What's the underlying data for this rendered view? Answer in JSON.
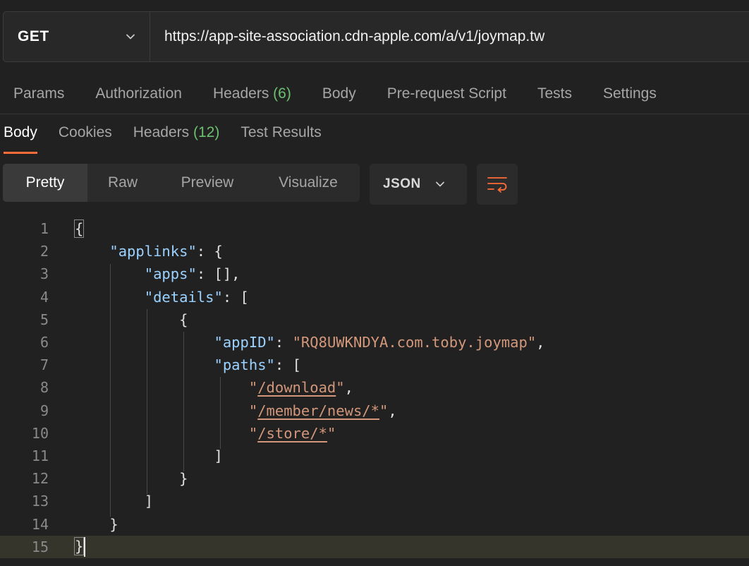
{
  "request": {
    "method": "GET",
    "url": "https://app-site-association.cdn-apple.com/a/v1/joymap.tw"
  },
  "request_tabs": [
    {
      "label": "Params"
    },
    {
      "label": "Authorization"
    },
    {
      "label": "Headers",
      "count": "(6)"
    },
    {
      "label": "Body"
    },
    {
      "label": "Pre-request Script"
    },
    {
      "label": "Tests"
    },
    {
      "label": "Settings"
    }
  ],
  "response_tabs": [
    {
      "label": "Body",
      "active": true
    },
    {
      "label": "Cookies"
    },
    {
      "label": "Headers",
      "count": "(12)"
    },
    {
      "label": "Test Results"
    }
  ],
  "view_modes": [
    "Pretty",
    "Raw",
    "Preview",
    "Visualize"
  ],
  "active_view": "Pretty",
  "format": "JSON",
  "icons": {
    "method_dropdown": "chevron-down-icon",
    "format_dropdown": "chevron-down-icon",
    "wrap": "wrap-lines-icon"
  },
  "colors": {
    "accent": "#ff6c37",
    "count": "#6cc070",
    "key": "#9cd2ff",
    "string": "#d3977b"
  },
  "code": {
    "current_line": 15,
    "lines": [
      {
        "n": "1",
        "parts": [
          {
            "t": "{",
            "c": "brace-box"
          }
        ]
      },
      {
        "n": "2",
        "parts": [
          {
            "t": "    "
          },
          {
            "t": "\"applinks\"",
            "c": "key"
          },
          {
            "t": ": {"
          }
        ]
      },
      {
        "n": "3",
        "parts": [
          {
            "t": "        "
          },
          {
            "t": "\"apps\"",
            "c": "key"
          },
          {
            "t": ": [],"
          }
        ]
      },
      {
        "n": "4",
        "parts": [
          {
            "t": "        "
          },
          {
            "t": "\"details\"",
            "c": "key"
          },
          {
            "t": ": ["
          }
        ]
      },
      {
        "n": "5",
        "parts": [
          {
            "t": "            {"
          }
        ]
      },
      {
        "n": "6",
        "parts": [
          {
            "t": "                "
          },
          {
            "t": "\"appID\"",
            "c": "key"
          },
          {
            "t": ": "
          },
          {
            "t": "\"RQ8UWKNDYA.com.toby.joymap\"",
            "c": "str"
          },
          {
            "t": ","
          }
        ]
      },
      {
        "n": "7",
        "parts": [
          {
            "t": "                "
          },
          {
            "t": "\"paths\"",
            "c": "key"
          },
          {
            "t": ": ["
          }
        ]
      },
      {
        "n": "8",
        "parts": [
          {
            "t": "                    "
          },
          {
            "t": "\"",
            "c": "str"
          },
          {
            "t": "/download",
            "c": "lnk"
          },
          {
            "t": "\"",
            "c": "str"
          },
          {
            "t": ","
          }
        ]
      },
      {
        "n": "9",
        "parts": [
          {
            "t": "                    "
          },
          {
            "t": "\"",
            "c": "str"
          },
          {
            "t": "/member/news/*",
            "c": "lnk"
          },
          {
            "t": "\"",
            "c": "str"
          },
          {
            "t": ","
          }
        ]
      },
      {
        "n": "10",
        "parts": [
          {
            "t": "                    "
          },
          {
            "t": "\"",
            "c": "str"
          },
          {
            "t": "/store/*",
            "c": "lnk"
          },
          {
            "t": "\"",
            "c": "str"
          }
        ]
      },
      {
        "n": "11",
        "parts": [
          {
            "t": "                ]"
          }
        ]
      },
      {
        "n": "12",
        "parts": [
          {
            "t": "            }"
          }
        ]
      },
      {
        "n": "13",
        "parts": [
          {
            "t": "        ]"
          }
        ]
      },
      {
        "n": "14",
        "parts": [
          {
            "t": "    }"
          }
        ]
      },
      {
        "n": "15",
        "parts": [
          {
            "t": "}",
            "c": "brace-box"
          }
        ]
      }
    ]
  }
}
